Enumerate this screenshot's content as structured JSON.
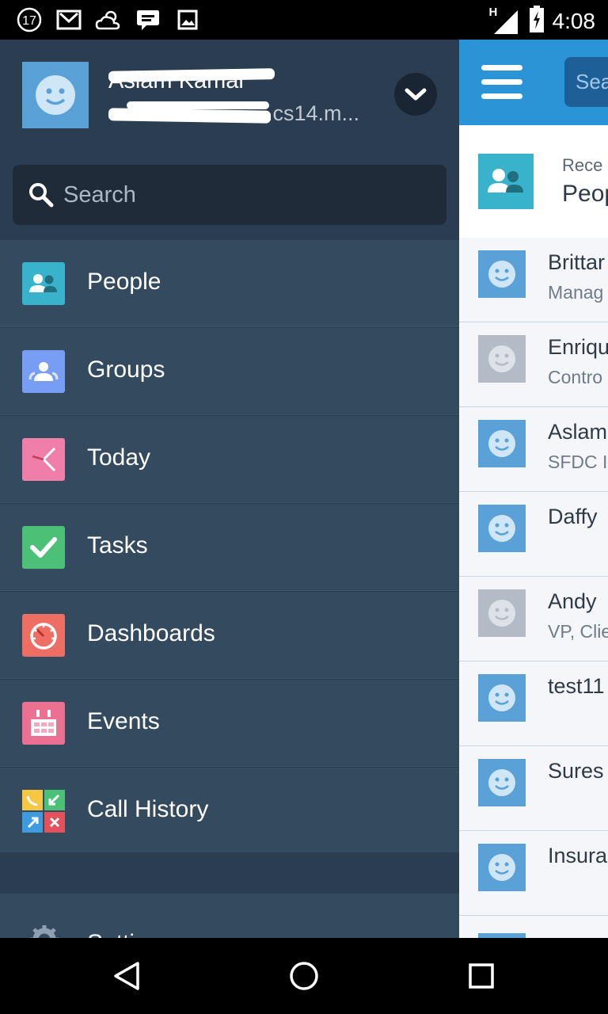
{
  "status_bar": {
    "notification_count": "17",
    "network_label": "H",
    "time": "4:08",
    "icons": [
      "notification-count-icon",
      "gmail-icon",
      "weather-icon",
      "chat-icon",
      "image-icon",
      "signal-icon",
      "battery-icon"
    ]
  },
  "drawer": {
    "profile": {
      "name": "Aslam Kamal",
      "org": ".cs14.m..."
    },
    "search": {
      "placeholder": "Search"
    },
    "menu": [
      {
        "label": "People",
        "icon": "people-icon",
        "color": "#39b3cc"
      },
      {
        "label": "Groups",
        "icon": "groups-icon",
        "color": "#779ef2"
      },
      {
        "label": "Today",
        "icon": "today-icon",
        "color": "#ef7ea9"
      },
      {
        "label": "Tasks",
        "icon": "tasks-icon",
        "color": "#4bc076"
      },
      {
        "label": "Dashboards",
        "icon": "dashboards-icon",
        "color": "#ef6e64"
      },
      {
        "label": "Events",
        "icon": "events-icon",
        "color": "#eb7092"
      },
      {
        "label": "Call History",
        "icon": "call-history-icon",
        "color": "#4bc076"
      }
    ],
    "settings_label": "Settings"
  },
  "main": {
    "search_partial": "Sea",
    "recent_label": "Rece",
    "recent_title": "Peop",
    "people": [
      {
        "name": "Brittar",
        "sub": "Manag",
        "avatar_color": "#5aa1d8"
      },
      {
        "name": "Enriqu",
        "sub": "Contro",
        "avatar_color": "#b3bcc6"
      },
      {
        "name": "Aslam",
        "sub": "SFDC I",
        "avatar_color": "#5aa1d8"
      },
      {
        "name": "Daffy",
        "sub": "",
        "avatar_color": "#5aa1d8"
      },
      {
        "name": "Andy",
        "sub": "VP, Clie",
        "avatar_color": "#b3bcc6"
      },
      {
        "name": "test11",
        "sub": "",
        "avatar_color": "#5aa1d8"
      },
      {
        "name": "Sures",
        "sub": "",
        "avatar_color": "#5aa1d8"
      },
      {
        "name": "Insura",
        "sub": "",
        "avatar_color": "#5aa1d8"
      }
    ]
  },
  "colors": {
    "drawer_bg": "#344a5f",
    "drawer_header_bg": "#2b3d51",
    "header_blue": "#2a94d6"
  }
}
